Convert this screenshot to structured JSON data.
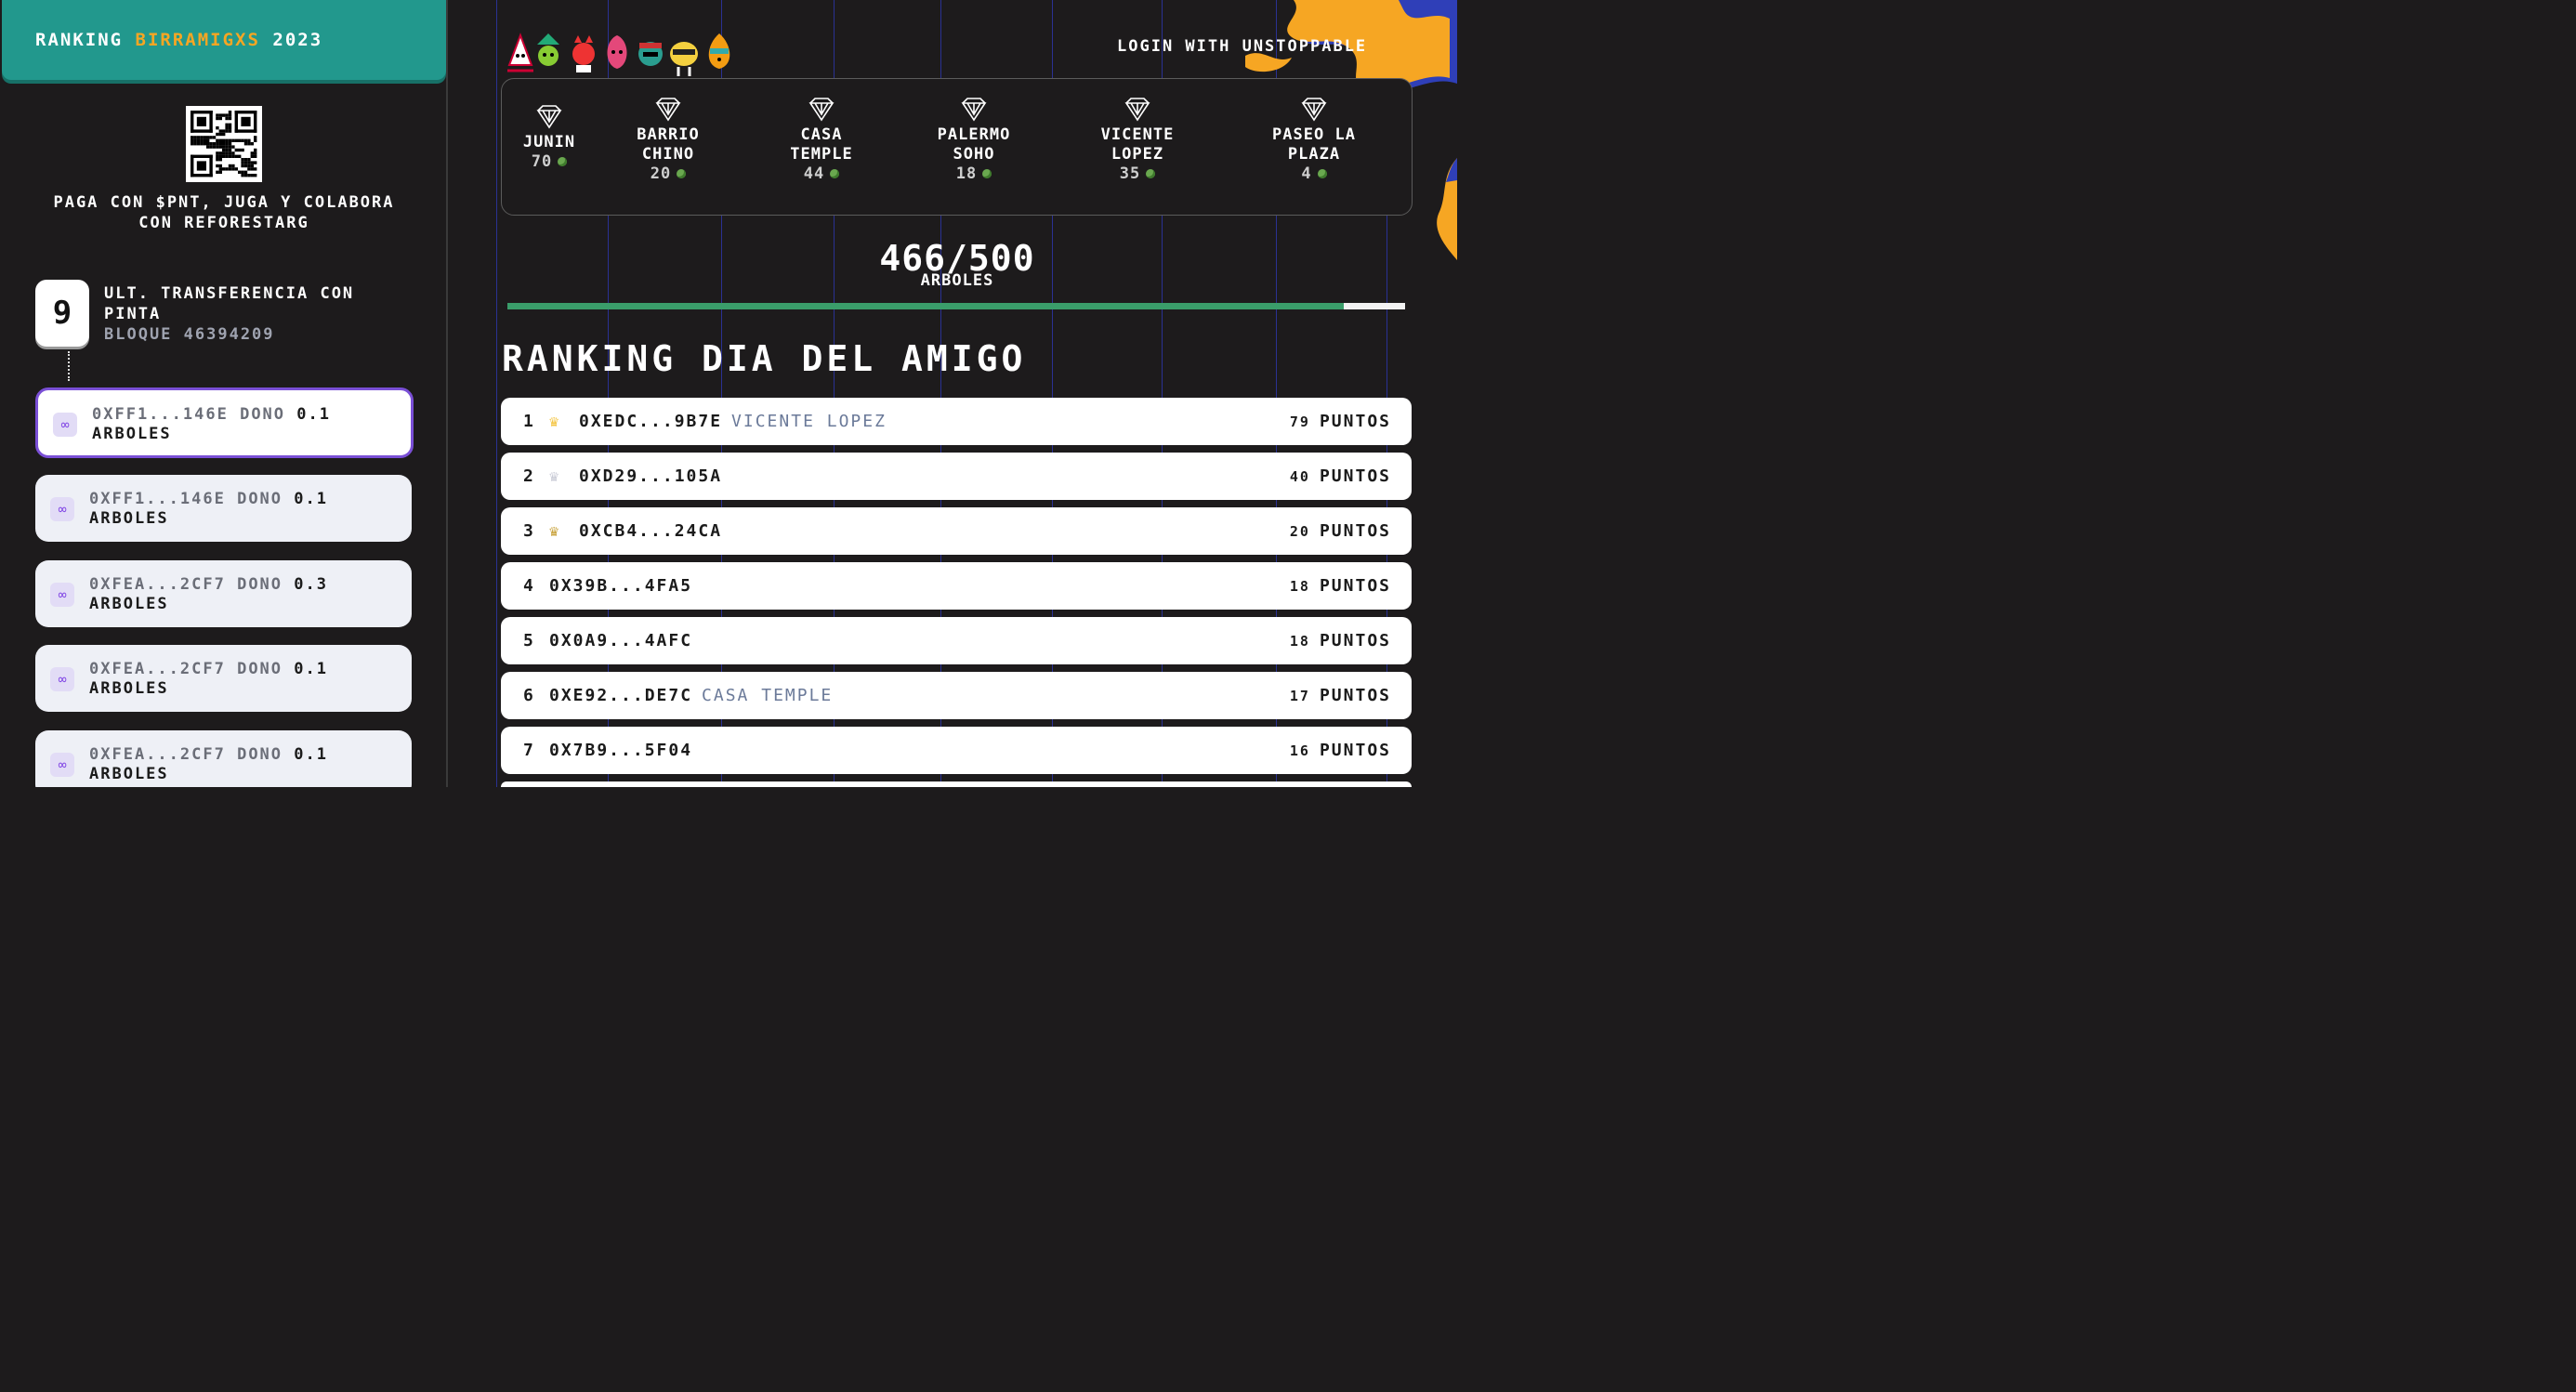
{
  "sidebar": {
    "title_prefix": "RANKING",
    "title_accent": "BIRRAMIGXS",
    "title_year": "2023",
    "tagline_line1": "PAGA CON $PNT, JUGA Y COLABORA",
    "tagline_line2": "CON REFORESTARG",
    "block_badge": "9",
    "block_label_line1": "ULT. TRANSFERENCIA CON",
    "block_label_line2": "PINTA",
    "block_number_line": "BLOQUE 46394209",
    "transfers": [
      {
        "addr": "0XFF1...146E",
        "verb": "DONO",
        "amount": "0.1",
        "unit": "ARBOLES"
      },
      {
        "addr": "0XFF1...146E",
        "verb": "DONO",
        "amount": "0.1",
        "unit": "ARBOLES"
      },
      {
        "addr": "0XFEA...2CF7",
        "verb": "DONO",
        "amount": "0.3",
        "unit": "ARBOLES"
      },
      {
        "addr": "0XFEA...2CF7",
        "verb": "DONO",
        "amount": "0.1",
        "unit": "ARBOLES"
      },
      {
        "addr": "0XFEA...2CF7",
        "verb": "DONO",
        "amount": "0.1",
        "unit": "ARBOLES"
      }
    ]
  },
  "header": {
    "login_label": "LOGIN WITH UNSTOPPABLE"
  },
  "bars": [
    {
      "line1": "JUNIN",
      "line2": "",
      "count": "70"
    },
    {
      "line1": "BARRIO",
      "line2": "CHINO",
      "count": "20"
    },
    {
      "line1": "CASA",
      "line2": "TEMPLE",
      "count": "44"
    },
    {
      "line1": "PALERMO",
      "line2": "SOHO",
      "count": "18"
    },
    {
      "line1": "VICENTE",
      "line2": "LOPEZ",
      "count": "35"
    },
    {
      "line1": "PASEO LA",
      "line2": "PLAZA",
      "count": "4"
    }
  ],
  "progress": {
    "text": "466/500",
    "label": "ARBOLES",
    "value": 466,
    "max": 500
  },
  "ranking": {
    "title": "RANKING DIA DEL AMIGO",
    "points_label": "PUNTOS",
    "rows": [
      {
        "pos": "1",
        "addr": "0XEDC...9B7E",
        "bar": "VICENTE LOPEZ",
        "points": "79",
        "crown": "gold"
      },
      {
        "pos": "2",
        "addr": "0XD29...105A",
        "bar": "",
        "points": "40",
        "crown": "silver"
      },
      {
        "pos": "3",
        "addr": "0XCB4...24CA",
        "bar": "",
        "points": "20",
        "crown": "bronze"
      },
      {
        "pos": "4",
        "addr": "0X39B...4FA5",
        "bar": "",
        "points": "18",
        "crown": ""
      },
      {
        "pos": "5",
        "addr": "0X0A9...4AFC",
        "bar": "",
        "points": "18",
        "crown": ""
      },
      {
        "pos": "6",
        "addr": "0XE92...DE7C",
        "bar": "CASA TEMPLE",
        "points": "17",
        "crown": ""
      },
      {
        "pos": "7",
        "addr": "0X7B9...5F04",
        "bar": "",
        "points": "16",
        "crown": ""
      }
    ]
  },
  "colors": {
    "accent_orange": "#f6a623",
    "header_teal": "#22988d",
    "progress_green": "#3a9d6a",
    "polygon_purple": "#8247e5",
    "crown_gold": "#f4c542",
    "crown_silver": "#c9cbd6",
    "crown_bronze": "#c9a33c"
  },
  "icons": {
    "bar_logo": "temple-logo-icon",
    "tree": "tree-icon",
    "transfer": "polygon-icon",
    "crown": "crown-icon"
  }
}
